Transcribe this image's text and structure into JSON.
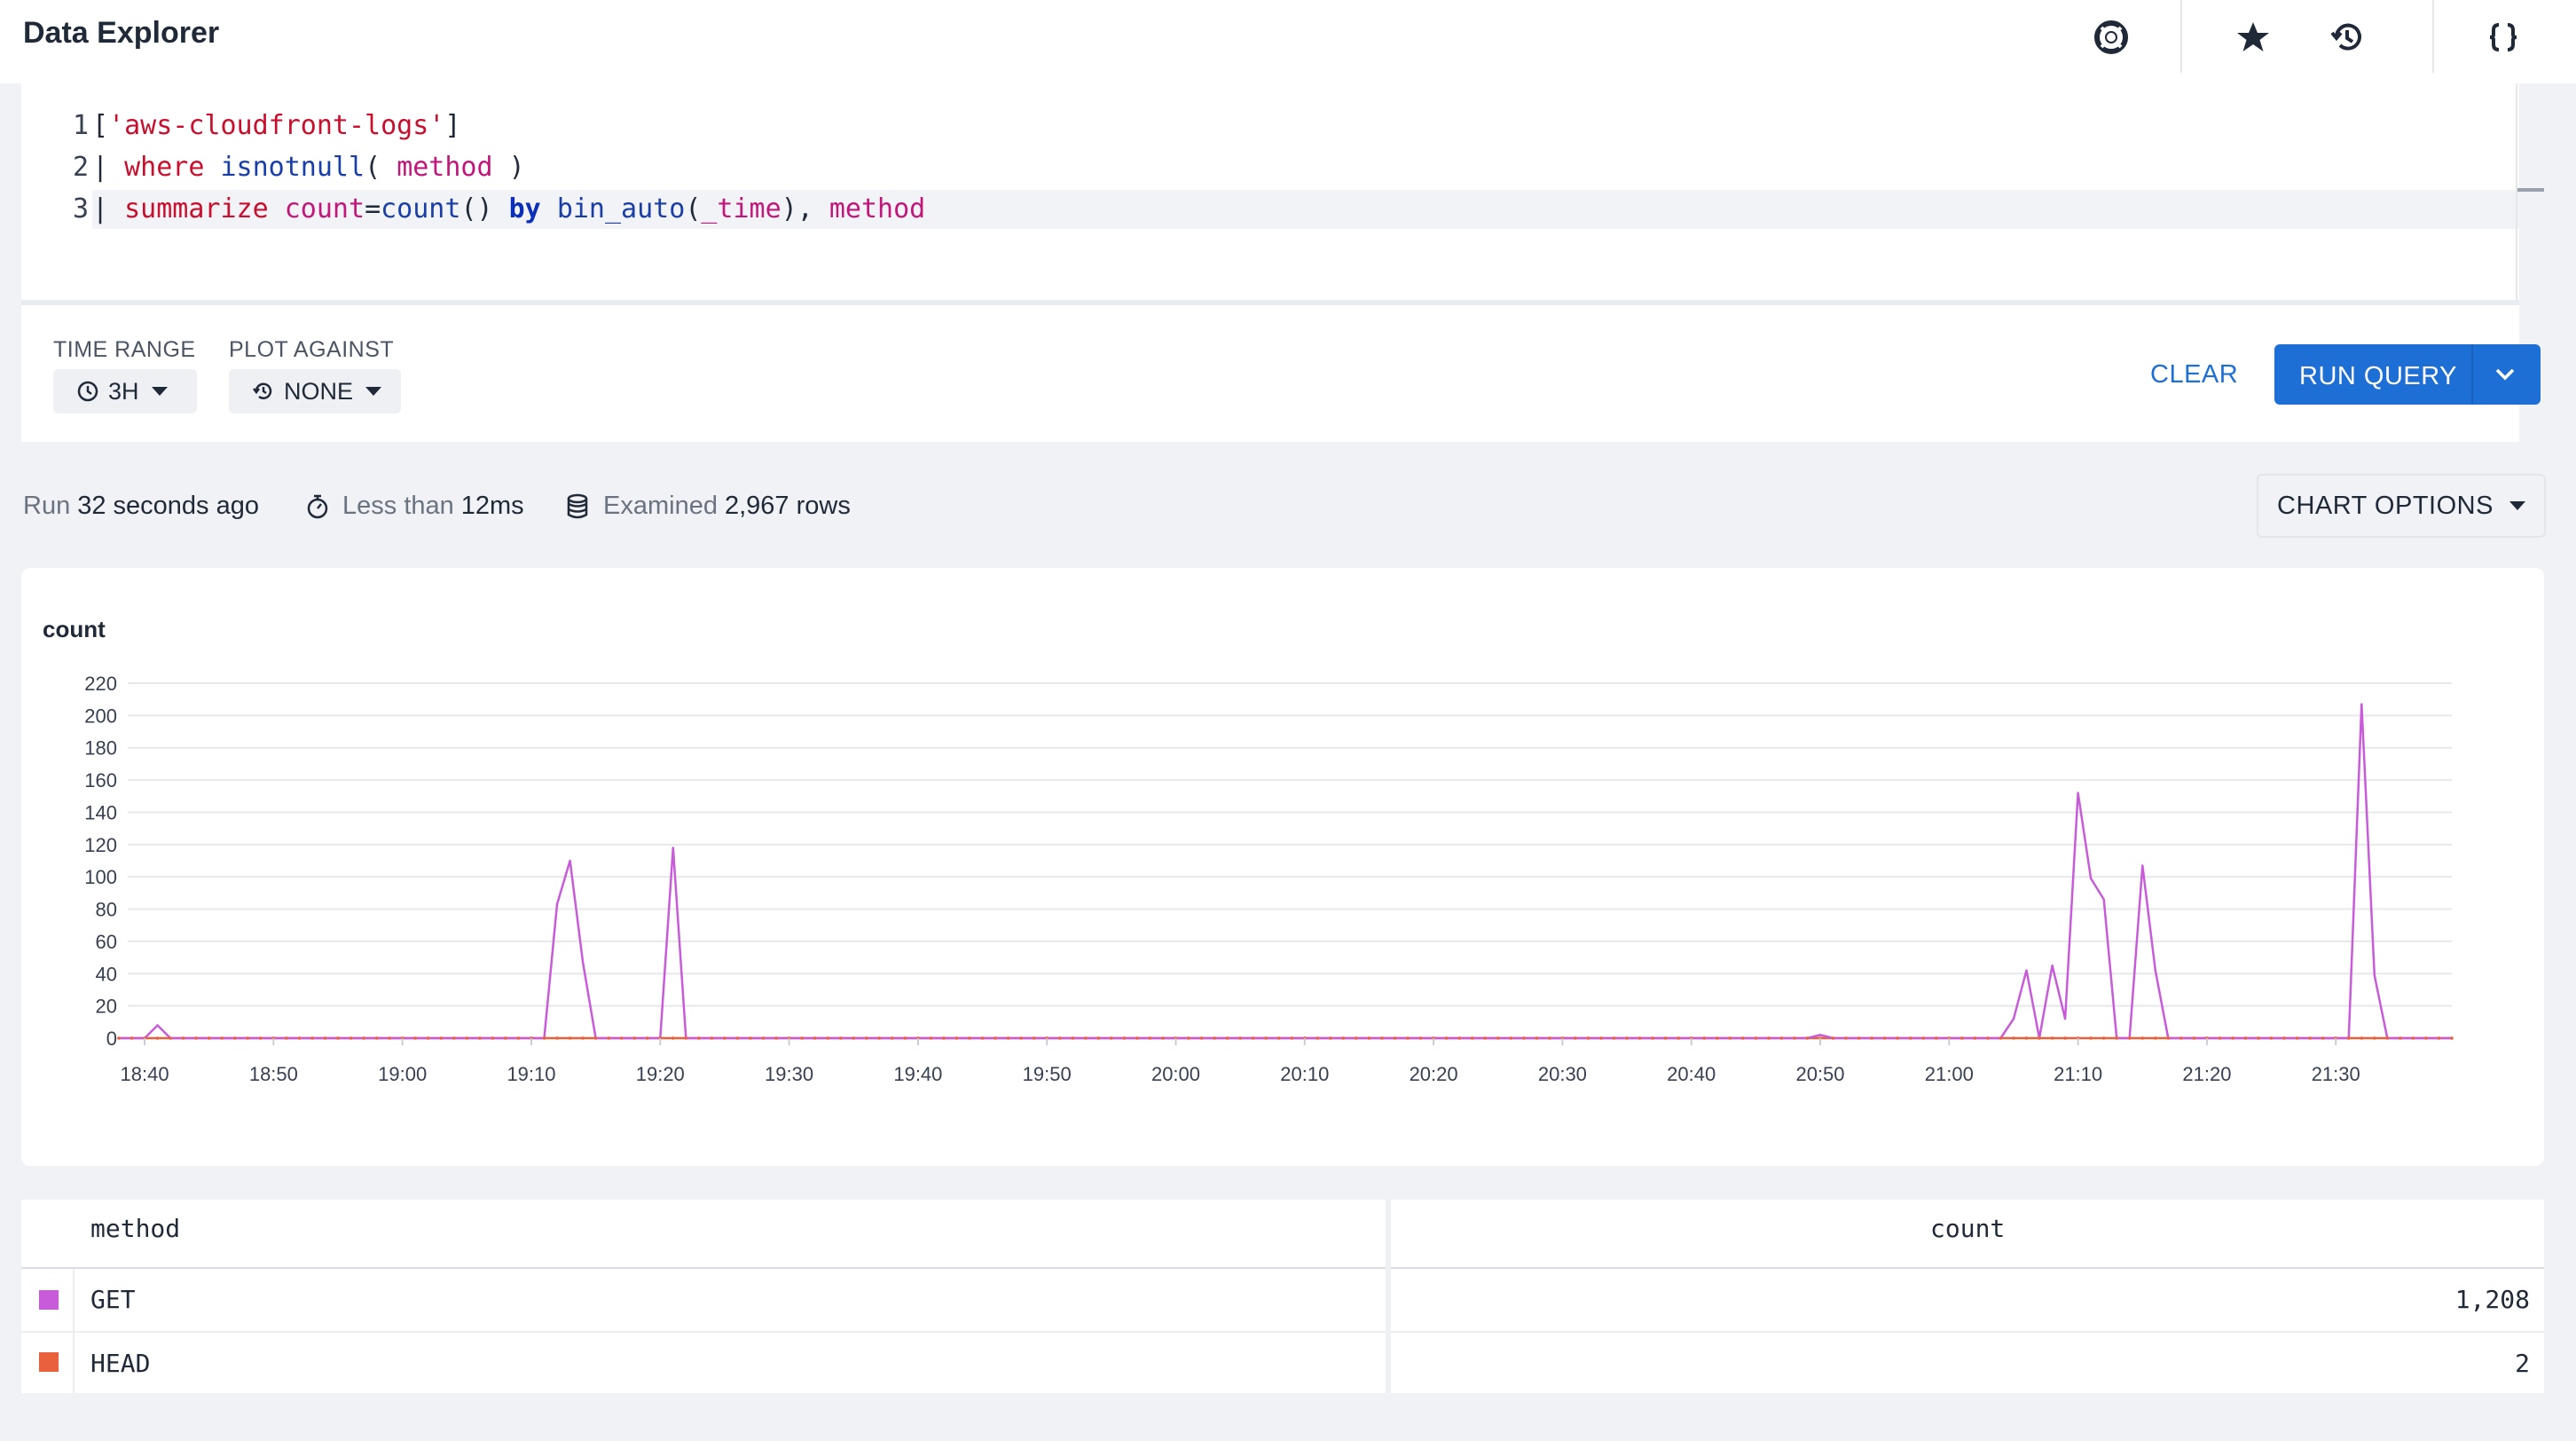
{
  "header": {
    "title": "Data Explorer",
    "icons": [
      "help-icon",
      "star-icon",
      "history-icon",
      "json-braces-icon"
    ]
  },
  "editor": {
    "line_numbers": [
      "1",
      "2",
      "3"
    ],
    "lines": [
      [
        {
          "t": "[",
          "c": "plain"
        },
        {
          "t": "'aws-cloudfront-logs'",
          "c": "red"
        },
        {
          "t": "]",
          "c": "plain"
        }
      ],
      [
        {
          "t": "| ",
          "c": "plain"
        },
        {
          "t": "where",
          "c": "red"
        },
        {
          "t": " ",
          "c": "plain"
        },
        {
          "t": "isnotnull",
          "c": "blue"
        },
        {
          "t": "( ",
          "c": "plain"
        },
        {
          "t": "method",
          "c": "pink"
        },
        {
          "t": " )",
          "c": "plain"
        }
      ],
      [
        {
          "t": "| ",
          "c": "plain"
        },
        {
          "t": "summarize",
          "c": "red"
        },
        {
          "t": " ",
          "c": "plain"
        },
        {
          "t": "count",
          "c": "pink"
        },
        {
          "t": "=",
          "c": "plain"
        },
        {
          "t": "count",
          "c": "blue"
        },
        {
          "t": "() ",
          "c": "plain"
        },
        {
          "t": "by",
          "c": "bold"
        },
        {
          "t": " ",
          "c": "plain"
        },
        {
          "t": "bin_auto",
          "c": "blue"
        },
        {
          "t": "(",
          "c": "plain"
        },
        {
          "t": "_time",
          "c": "pink"
        },
        {
          "t": "), ",
          "c": "plain"
        },
        {
          "t": "method",
          "c": "pink"
        }
      ]
    ]
  },
  "toolbar": {
    "time_range_label": "TIME RANGE",
    "time_range_value": "3H",
    "plot_against_label": "PLOT AGAINST",
    "plot_against_value": "NONE",
    "clear_label": "CLEAR",
    "run_label": "RUN QUERY"
  },
  "status": {
    "run_prefix": "Run",
    "run_value": "32 seconds ago",
    "duration_prefix": "Less than",
    "duration_value": "12ms",
    "examined_prefix": "Examined",
    "examined_value": "2,967 rows",
    "chart_options_label": "CHART OPTIONS"
  },
  "colors": {
    "accent": "#1d6fd6",
    "get_series": "#c85bd9",
    "head_series": "#e8613c"
  },
  "chart_data": {
    "type": "line",
    "title": "count",
    "xlabel": "",
    "ylabel": "",
    "x_ticks": [
      "18:40",
      "18:50",
      "19:00",
      "19:10",
      "19:20",
      "19:30",
      "19:40",
      "19:50",
      "20:00",
      "20:10",
      "20:20",
      "20:30",
      "20:40",
      "20:50",
      "21:00",
      "21:10",
      "21:20",
      "21:30"
    ],
    "y_ticks": [
      0,
      20,
      40,
      60,
      80,
      100,
      120,
      140,
      160,
      180,
      200,
      220
    ],
    "ylim": [
      0,
      220
    ],
    "xlim": [
      "18:38",
      "21:39"
    ],
    "grid": true,
    "series": [
      {
        "name": "GET",
        "color": "#c85bd9",
        "points": [
          [
            "18:38",
            0
          ],
          [
            "18:40",
            0
          ],
          [
            "18:41",
            8
          ],
          [
            "18:42",
            0
          ],
          [
            "19:11",
            0
          ],
          [
            "19:12",
            83
          ],
          [
            "19:13",
            110
          ],
          [
            "19:14",
            47
          ],
          [
            "19:15",
            0
          ],
          [
            "19:20",
            0
          ],
          [
            "19:21",
            118
          ],
          [
            "19:22",
            0
          ],
          [
            "20:49",
            0
          ],
          [
            "20:50",
            2
          ],
          [
            "20:51",
            0
          ],
          [
            "21:04",
            0
          ],
          [
            "21:05",
            12
          ],
          [
            "21:06",
            42
          ],
          [
            "21:07",
            0
          ],
          [
            "21:08",
            45
          ],
          [
            "21:09",
            12
          ],
          [
            "21:10",
            152
          ],
          [
            "21:11",
            99
          ],
          [
            "21:12",
            86
          ],
          [
            "21:13",
            0
          ],
          [
            "21:14",
            0
          ],
          [
            "21:15",
            107
          ],
          [
            "21:16",
            42
          ],
          [
            "21:17",
            0
          ],
          [
            "21:31",
            0
          ],
          [
            "21:32",
            207
          ],
          [
            "21:33",
            39
          ],
          [
            "21:34",
            0
          ],
          [
            "21:39",
            0
          ]
        ]
      },
      {
        "name": "HEAD",
        "color": "#e8613c",
        "points": [
          [
            "18:38",
            0
          ],
          [
            "21:39",
            0
          ]
        ]
      }
    ]
  },
  "table": {
    "headers": [
      "method",
      "count"
    ],
    "rows": [
      {
        "method": "GET",
        "count": "1,208",
        "color": "#c85bd9"
      },
      {
        "method": "HEAD",
        "count": "2",
        "color": "#e8613c"
      }
    ]
  }
}
